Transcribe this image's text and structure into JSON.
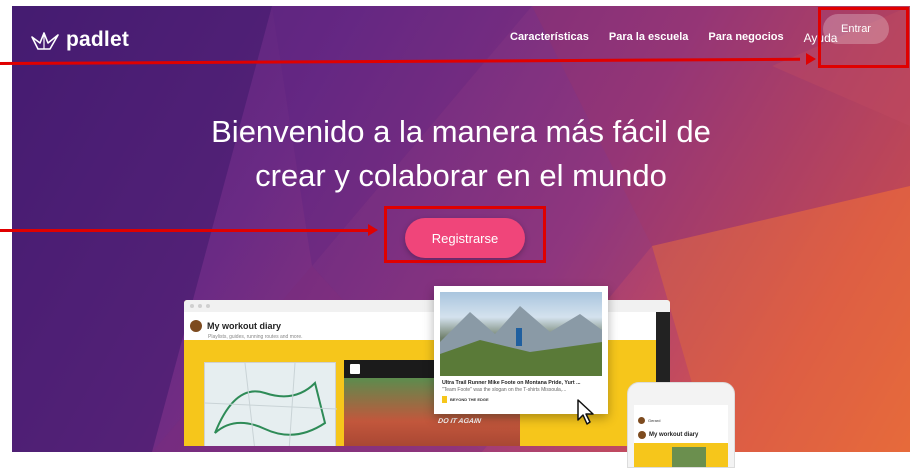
{
  "nav": {
    "brand": "padlet",
    "links": [
      "Características",
      "Para la escuela",
      "Para negocios"
    ],
    "help": "Ayuda",
    "login": "Entrar"
  },
  "hero": {
    "headline_line1": "Bienvenido a la manera más fácil de",
    "headline_line2": "crear y colaborar en el mundo",
    "cta": "Registrarse"
  },
  "mockup": {
    "board_title": "My workout diary",
    "board_subtitle": "Playlists, guides, running routes and more.",
    "video_caption": "DO IT AGAIN",
    "card_title": "Ultra Trail Runner Mike Foote on Montana Pride, Yurt ...",
    "card_subtitle": "\"Team Foote\" was the slogan on the T-shirts Missoula,...",
    "card_source": "BEYOND THE EDGE",
    "phone_user": "Gerard",
    "phone_title": "My workout diary"
  },
  "colors": {
    "cta_bg": "#f0457a",
    "annotation": "#e00000",
    "board_yellow": "#f6c61b"
  }
}
